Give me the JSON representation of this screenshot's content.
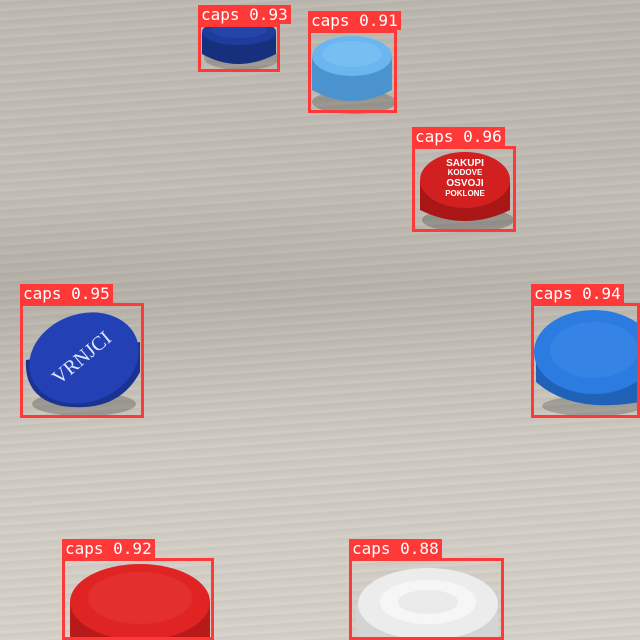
{
  "image": {
    "surface": "light wood-grain tabletop",
    "box_color": "#ff3838",
    "label_text_color": "#ffffff"
  },
  "detections": [
    {
      "label": "caps 0.93",
      "class": "caps",
      "confidence": 0.93,
      "cap_color": "#1e3c9c",
      "cap_text": ""
    },
    {
      "label": "caps 0.91",
      "class": "caps",
      "confidence": 0.91,
      "cap_color": "#5aa8e6",
      "cap_text": ""
    },
    {
      "label": "caps 0.96",
      "class": "caps",
      "confidence": 0.96,
      "cap_color": "#d22020",
      "cap_text": "SAKUPI KODOVE OSVOJI POKLONE"
    },
    {
      "label": "caps 0.95",
      "class": "caps",
      "confidence": 0.95,
      "cap_color": "#2341b4",
      "cap_text": "VRNJCI"
    },
    {
      "label": "caps 0.94",
      "class": "caps",
      "confidence": 0.94,
      "cap_color": "#2c7be0",
      "cap_text": ""
    },
    {
      "label": "caps 0.92",
      "class": "caps",
      "confidence": 0.92,
      "cap_color": "#e02424",
      "cap_text": ""
    },
    {
      "label": "caps 0.88",
      "class": "caps",
      "confidence": 0.88,
      "cap_color": "#ececec",
      "cap_text": ""
    }
  ]
}
